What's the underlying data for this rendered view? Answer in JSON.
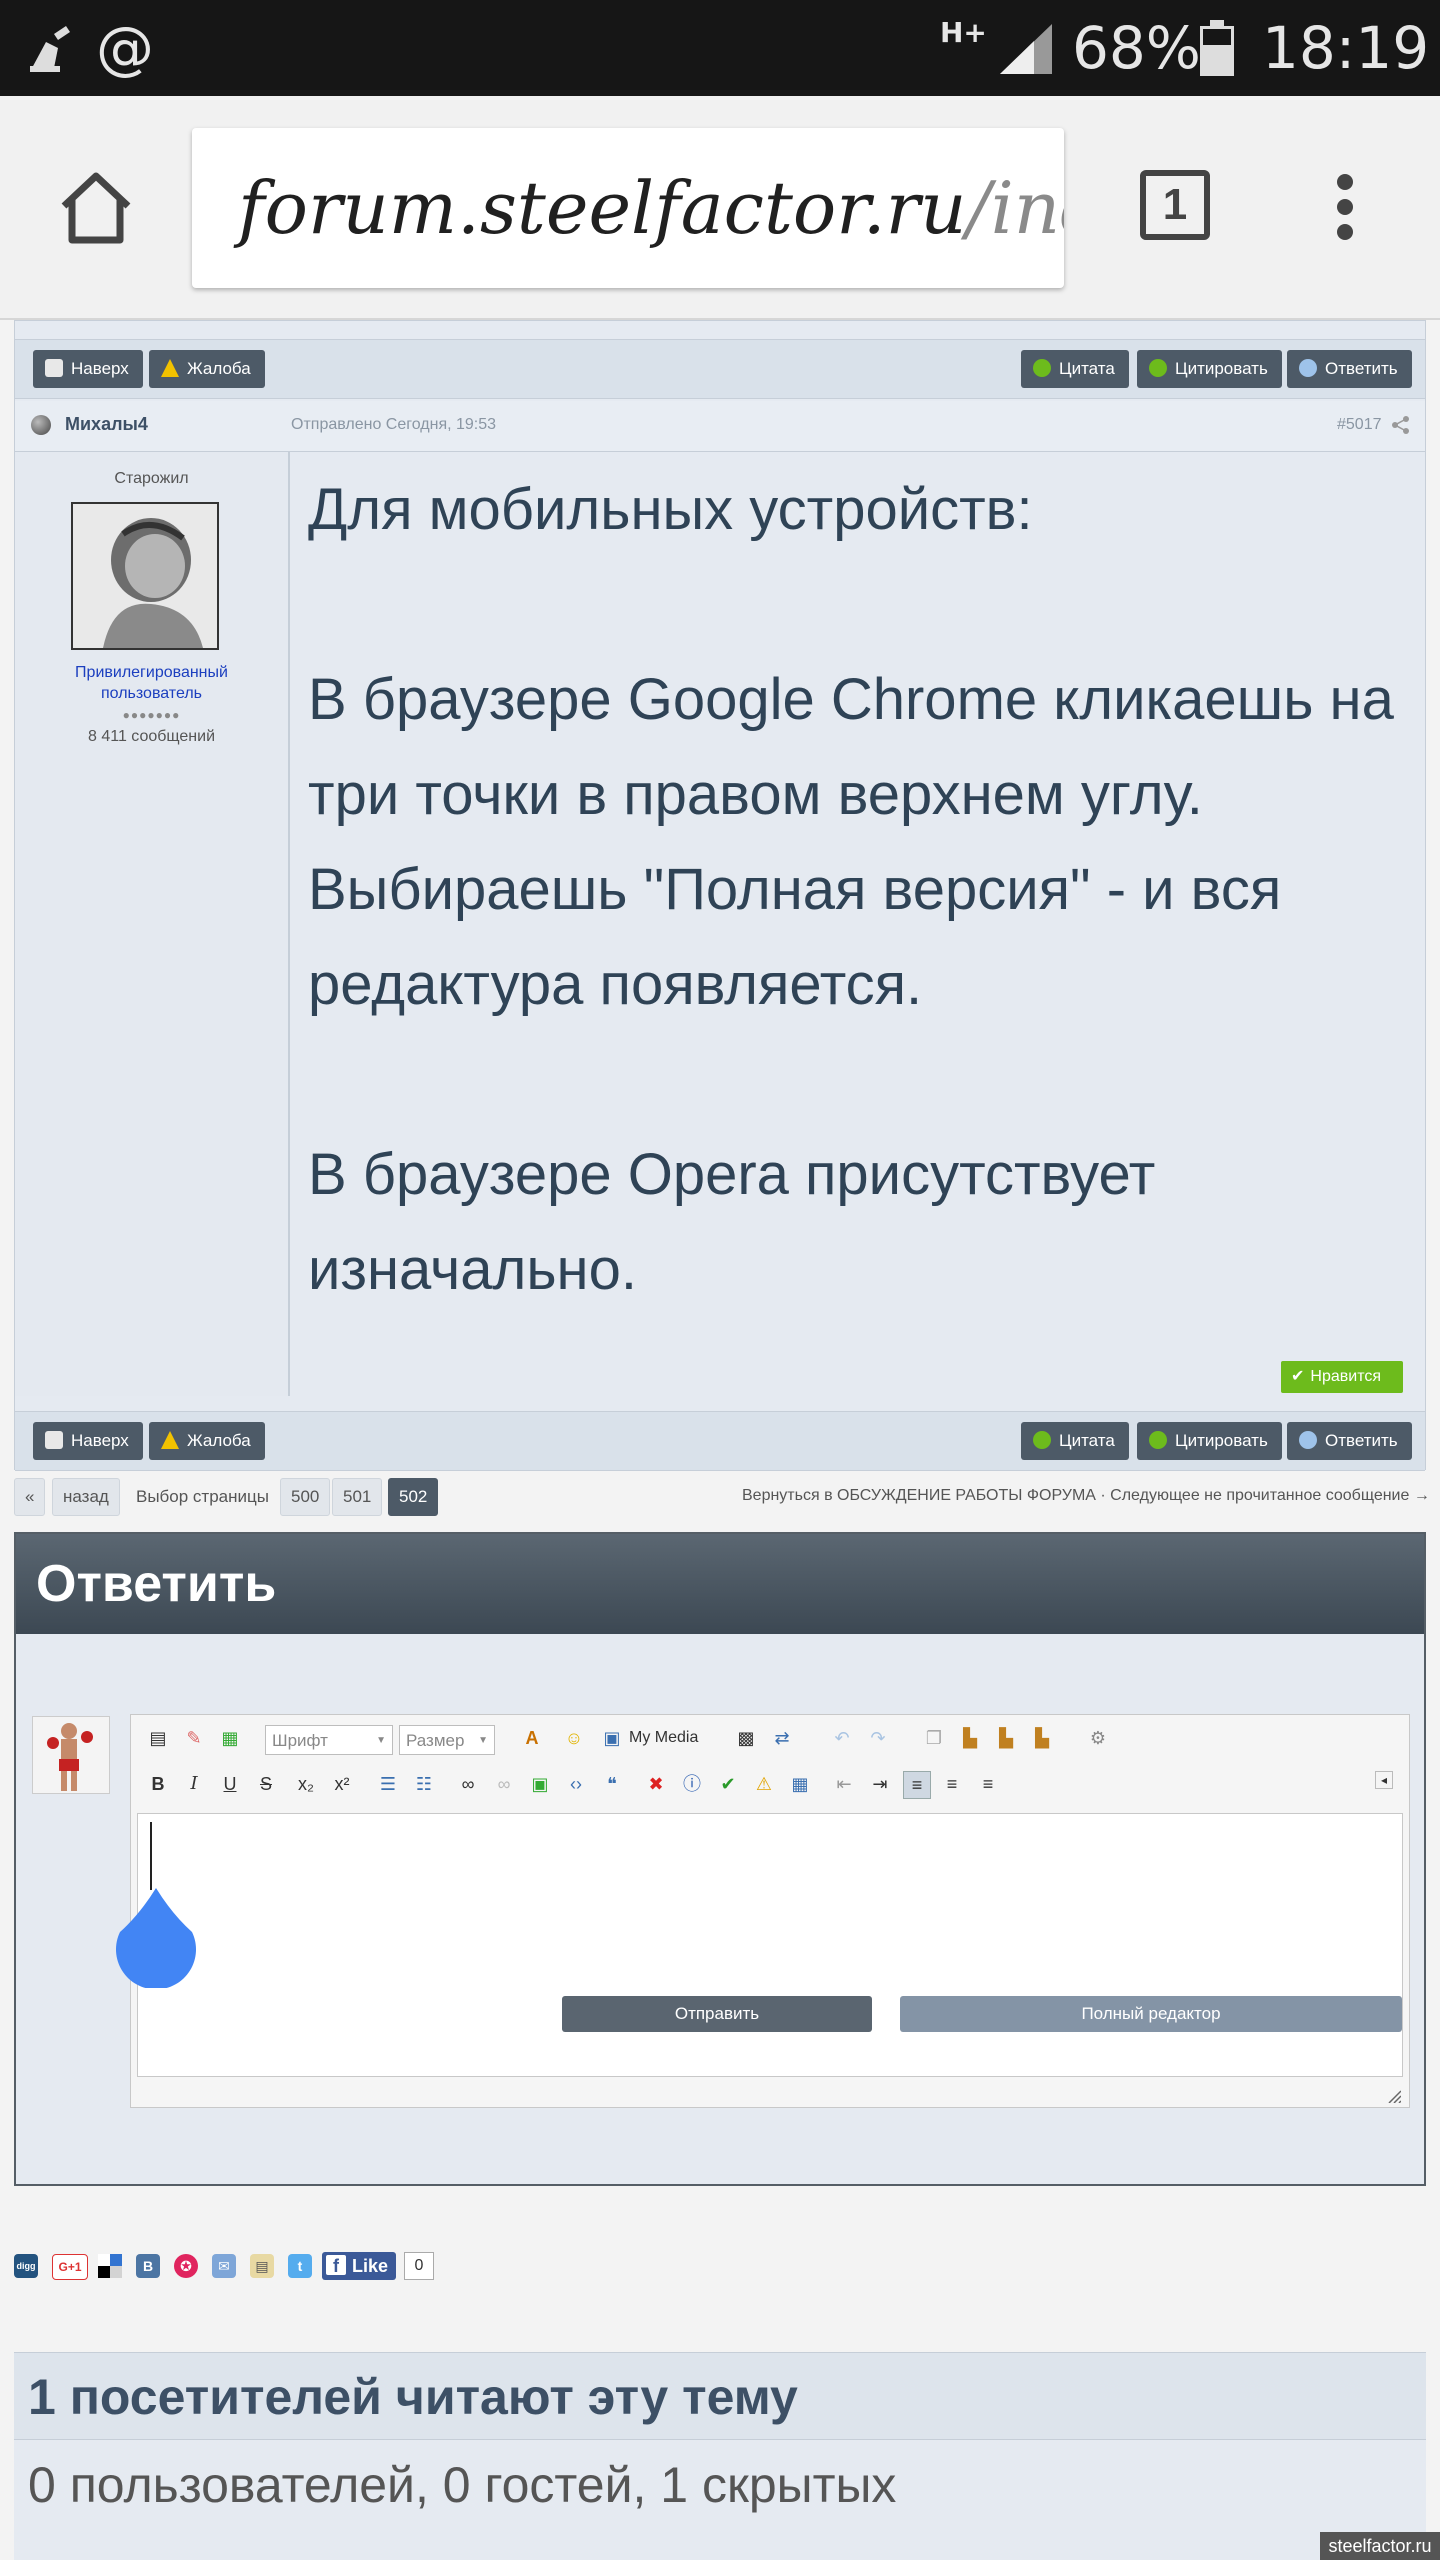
{
  "status_bar": {
    "network": "H+",
    "battery_percent": "68%",
    "time": "18:19",
    "left_icons": [
      "cleaner-icon",
      "at-icon"
    ]
  },
  "browser": {
    "url_main": "forum.steelfactor.ru",
    "url_rest": "/ind",
    "tab_count": "1"
  },
  "post": {
    "top_buttons": {
      "up": "Наверх",
      "report": "Жалоба",
      "quote": "Цитата",
      "multiquote": "Цитировать",
      "reply": "Ответить"
    },
    "author": {
      "name": "Михалы4",
      "rank": "Старожил",
      "group": "Привилегированный пользователь",
      "pips": "●●●●●●●",
      "posts": "8 411 сообщений"
    },
    "posted": "Отправлено Сегодня, 19:53",
    "number": "#5017",
    "paragraphs": [
      "Для мобильных устройств:",
      "В браузере Google Chrome кликаешь на три точки в правом верхнем углу. Выбираешь \"Полная версия\" - и вся редактура появляется.",
      "В браузере Opera присутствует изначально."
    ],
    "like_label": "Нравится",
    "bottom_buttons": {
      "up": "Наверх",
      "report": "Жалоба",
      "quote": "Цитата",
      "multiquote": "Цитировать",
      "reply": "Ответить"
    }
  },
  "pagination": {
    "first": "«",
    "prev": "назад",
    "label": "Выбор страницы",
    "pages": [
      "500",
      "501",
      "502"
    ],
    "current": "502",
    "right_links": "Вернуться в ОБСУЖДЕНИЕ РАБОТЫ ФОРУМА · Следующее не прочитанное сообщение →"
  },
  "reply": {
    "title": "Ответить",
    "font_placeholder": "Шрифт",
    "size_placeholder": "Размер",
    "my_media": "My Media",
    "submit": "Отправить",
    "full_editor": "Полный редактор"
  },
  "share": {
    "icons": [
      "digg-icon",
      "google-plus-icon",
      "delicious-icon",
      "vk-icon",
      "star-icon",
      "email-icon",
      "print-icon",
      "twitter-icon"
    ],
    "gplus_label": "G+1",
    "fb_like": "Like",
    "fb_count": "0"
  },
  "viewers": {
    "title": "1 посетителей читают эту тему",
    "detail": "0 пользователей, 0 гостей, 1 скрытых"
  },
  "watermark": "steelfactor.ru",
  "colors": {
    "status_bg": "#161616",
    "button_dark": "#4d5a67",
    "post_text": "#2f4356",
    "like_green": "#6dbb1c",
    "cursor_handle": "#4285f4"
  }
}
